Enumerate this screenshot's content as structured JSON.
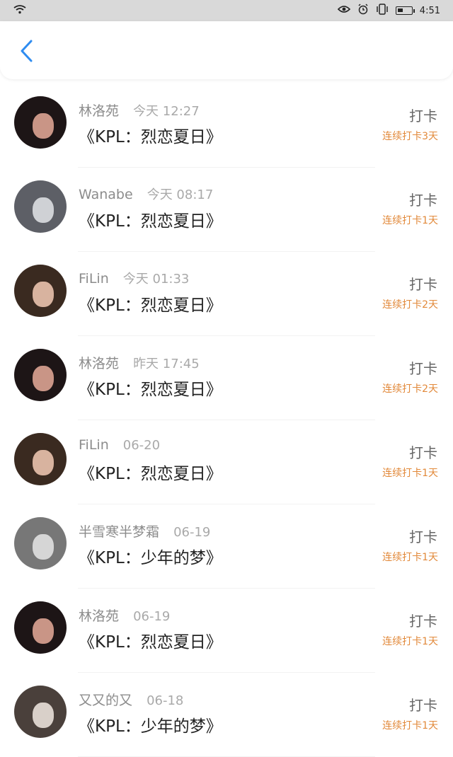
{
  "status_bar": {
    "wifi_icon": "wifi-icon",
    "eye_icon": "eye-icon",
    "alarm_icon": "alarm-icon",
    "vibrate_icon": "vibrate-icon",
    "battery_icon": "battery-icon",
    "time": "4:51"
  },
  "nav": {
    "back_icon": "chevron-left-icon",
    "accent": "#2f8cf0"
  },
  "list": [
    {
      "name": "林洛苑",
      "time": "今天 12:27",
      "title": "《KPL：烈恋夏日》",
      "action": "打卡",
      "streak": "连续打卡3天",
      "avatar": "dark-hair"
    },
    {
      "name": "Wanabe",
      "time": "今天 08:17",
      "title": "《KPL：烈恋夏日》",
      "action": "打卡",
      "streak": "连续打卡1天",
      "avatar": "gray"
    },
    {
      "name": "FiLin",
      "time": "今天 01:33",
      "title": "《KPL：烈恋夏日》",
      "action": "打卡",
      "streak": "连续打卡2天",
      "avatar": "warm"
    },
    {
      "name": "林洛苑",
      "time": "昨天 17:45",
      "title": "《KPL：烈恋夏日》",
      "action": "打卡",
      "streak": "连续打卡2天",
      "avatar": "dark-hair"
    },
    {
      "name": "FiLin",
      "time": "06-20",
      "title": "《KPL：烈恋夏日》",
      "action": "打卡",
      "streak": "连续打卡1天",
      "avatar": "warm"
    },
    {
      "name": "半雪寒半梦霜",
      "time": "06-19",
      "title": "《KPL：少年的梦》",
      "action": "打卡",
      "streak": "连续打卡1天",
      "avatar": "bw"
    },
    {
      "name": "林洛苑",
      "time": "06-19",
      "title": "《KPL：烈恋夏日》",
      "action": "打卡",
      "streak": "连续打卡1天",
      "avatar": "dark-hair"
    },
    {
      "name": "又又的又",
      "time": "06-18",
      "title": "《KPL：少年的梦》",
      "action": "打卡",
      "streak": "连续打卡1天",
      "avatar": "light"
    }
  ]
}
